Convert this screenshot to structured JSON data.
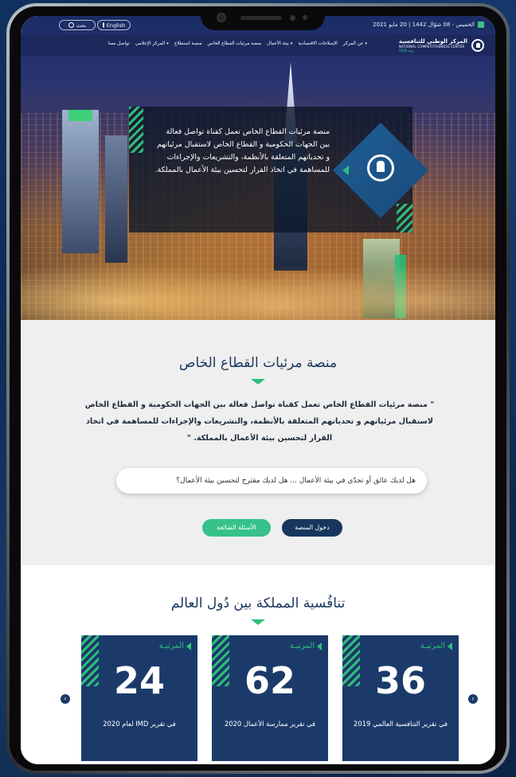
{
  "topbar": {
    "date": "الخميس - 08 شوّال 1442 | 20 مايو 2021",
    "search_label": "بحث",
    "lang_label": "English"
  },
  "logo": {
    "ar": "المركز الوطني للتنافسية",
    "en": "NATIONAL COMPETITIVENESS CENTER",
    "vision": "رؤية 2030"
  },
  "nav": {
    "items": [
      {
        "label": "عن المركز",
        "caret": true
      },
      {
        "label": "الإصلاحات الاقتصادية",
        "caret": false
      },
      {
        "label": "بيئة الأعمال",
        "caret": true
      },
      {
        "label": "منصة مرئيات القطاع الخاص",
        "caret": false
      },
      {
        "label": "منصة استطلاع",
        "caret": false
      },
      {
        "label": "المركز الإعلامي",
        "caret": true
      },
      {
        "label": "تواصل معنا",
        "caret": false
      }
    ]
  },
  "hero": {
    "text": "منصة مرئيات القطاع الخاص تعمل كقناة تواصل فعالة بين الجهات الحكومية و القطاع الخاص لاستقبال مرئياتهم و تحدياتهم المتعلقة بالأنظمة، والتشريعات والإجراءات للمساهمة في اتخاذ القرار لتحسين بيئة الأعمال بالمملكة."
  },
  "platform": {
    "title": "منصة مرئيات القطاع الخاص",
    "description": "\" منصة مرئيات القطاع الخاص تعمل كقناة تواصل فعالة بين الجهات الحكومية و القطاع الخاص لاستقبال مرئياتهم و تحدياتهم المتعلقة بالأنظمة، والتشريعات والإجراءات للمساهمة في اتخاذ القرار لتحسين بيئة الأعمال بالمملكة. \"",
    "suggest_text": "هل لديك عائق أو تحدّي في بيئة الأعمال ... هل لديك مقترح لتحسين بيئة الأعمال؟",
    "enter_label": "دخول المنصة",
    "faq_label": "الأسئلة الشائعة"
  },
  "competitiveness": {
    "title": "تنافُسية المملكة بين دُول العالم",
    "cards": [
      {
        "rank_label": "المرتبـة",
        "value": "36",
        "caption": "في تقرير التنافسية العالمي 2019"
      },
      {
        "rank_label": "المرتبـة",
        "value": "62",
        "caption": "في تقرير ممارسة الأعمال 2020"
      },
      {
        "rank_label": "المرتبـة",
        "value": "24",
        "caption": "في تقرير IMD لعام 2020"
      }
    ]
  },
  "colors": {
    "navy": "#17365e",
    "green": "#2fbf7a",
    "card": "#1b3a6a"
  }
}
